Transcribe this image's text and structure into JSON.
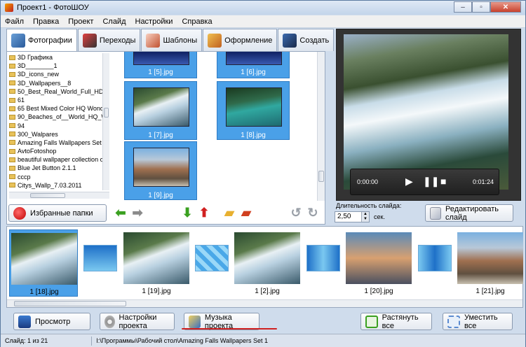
{
  "window": {
    "title": "Проект1 - ФотоШОУ"
  },
  "menu": [
    "Файл",
    "Правка",
    "Проект",
    "Слайд",
    "Настройки",
    "Справка"
  ],
  "tabs": [
    {
      "label": "Фотографии",
      "icon": "photos-icon",
      "active": true
    },
    {
      "label": "Переходы",
      "icon": "transitions-icon"
    },
    {
      "label": "Шаблоны",
      "icon": "templates-icon"
    },
    {
      "label": "Оформление",
      "icon": "design-icon"
    },
    {
      "label": "Создать",
      "icon": "create-icon"
    }
  ],
  "folders": [
    "3D Графика",
    "3D________1",
    "3D_icons_new",
    "3D_Wallpapers__8",
    "50_Best_Real_World_Full_HD_",
    "61",
    "65 Best Mixed Color HQ Wonde",
    "90_Beaches_of__World_HQ_W",
    "94",
    "300_Walpares",
    "Amazing Falls Wallpapers Set 1",
    "AvtoFotoshop",
    "beautiful wallpaper collection of",
    "Blue Jet Button 2.1.1",
    "cccp",
    "Citys_Wallp_7.03.2011"
  ],
  "thumbnails": [
    "1 [5].jpg",
    "1 [6].jpg",
    "1 [7].jpg",
    "1 [8].jpg",
    "1 [9].jpg"
  ],
  "buttons": {
    "favorites": "Избранные папки",
    "edit_slide": "Редактировать слайд",
    "preview": "Просмотр",
    "project_settings": "Настройки проекта",
    "project_music": "Музыка проекта",
    "stretch_all": "Растянуть все",
    "fit_all": "Уместить все"
  },
  "player": {
    "current_time": "0:00:00",
    "total_time": "0:01:24"
  },
  "slide_duration": {
    "label": "Длительность слайда:",
    "value": "2,50",
    "unit": "сек."
  },
  "slides": [
    "1 [18].jpg",
    "1 [19].jpg",
    "1 [2].jpg",
    "1 [20].jpg",
    "1 [21].jpg"
  ],
  "status": {
    "slide": "Слайд: 1 из 21",
    "path": "I:\\Программы\\Рабочий стол\\Amazing Falls Wallpapers Set 1"
  }
}
